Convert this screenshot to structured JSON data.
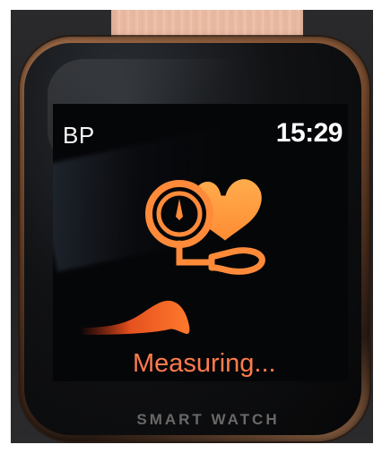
{
  "device": {
    "strap_color": "#e8b9a0",
    "case_color": "#8a5a3c",
    "brand_label": "SMART WATCH"
  },
  "screen": {
    "mode_label": "BP",
    "time": "15:29",
    "status_text": "Measuring...",
    "accent_color": "#ff7b4d",
    "icon": "blood-pressure-heart-icon"
  }
}
